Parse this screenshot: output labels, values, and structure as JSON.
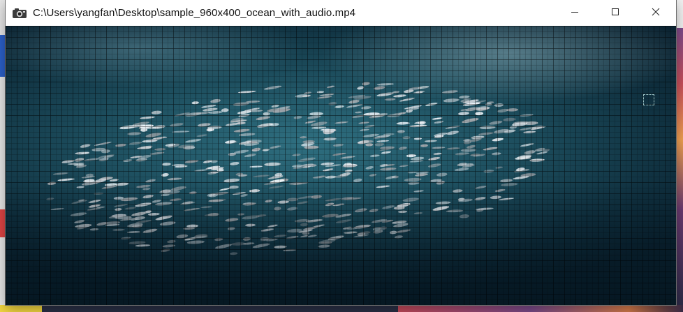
{
  "window": {
    "title": "C:\\Users\\yangfan\\Desktop\\sample_960x400_ocean_with_audio.mp4",
    "app_icon": "camera-icon",
    "controls": {
      "minimize_icon": "minimize-icon",
      "maximize_icon": "maximize-icon",
      "close_icon": "close-icon"
    }
  },
  "video": {
    "content": "video-frame"
  },
  "colors": {
    "titlebar_bg": "#ffffff",
    "title_text": "#111111",
    "water_mid": "#1d4e5e",
    "water_dark": "#0a2230"
  }
}
